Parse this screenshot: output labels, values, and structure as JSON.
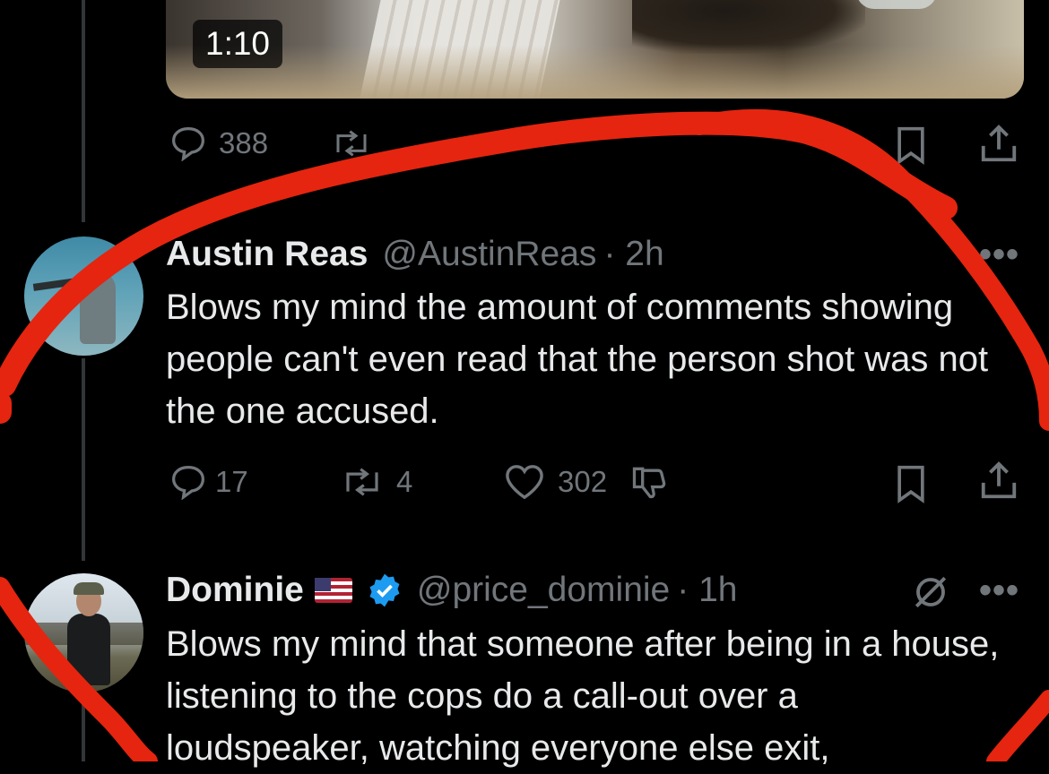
{
  "video": {
    "duration": "1:10"
  },
  "top_actions": {
    "replies": "388",
    "reposts": ""
  },
  "tweets": [
    {
      "name": "Austin Reas",
      "handle": "@AustinReas",
      "time": "· 2h",
      "text": "Blows my mind the amount of comments showing people can't even read that the person shot was not the one accused.",
      "replies": "17",
      "reposts": "4",
      "likes": "302"
    },
    {
      "name": "Dominie",
      "handle": "@price_dominie",
      "time": "· 1h",
      "text": "Blows my mind that someone after being in a house, listening to the cops do a call-out over a loudspeaker, watching everyone else exit,"
    }
  ],
  "more_label": "•••",
  "colors": {
    "background": "#000000",
    "text": "#e7e9ea",
    "muted": "#71767b",
    "verified": "#1d9bf0",
    "annotation": "#e5250f"
  }
}
